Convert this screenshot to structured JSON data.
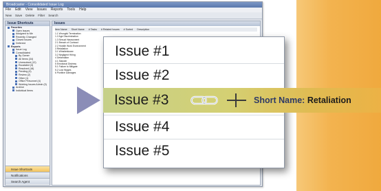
{
  "app": {
    "title": "Broadcaster - Consolidated Issue Log",
    "menu": [
      "File",
      "Edit",
      "View",
      "Issues",
      "Reports",
      "Tools",
      "Help"
    ],
    "toolbar": [
      "New",
      "Save",
      "Delete",
      "Filter",
      "Search"
    ]
  },
  "left_pane": {
    "header": "Issue Shortcuts",
    "items": [
      {
        "label": "Favorites",
        "level": "sec"
      },
      {
        "label": "Open Issues",
        "level": "l1"
      },
      {
        "label": "Assigned to Me",
        "level": "l1"
      },
      {
        "label": "Recently Changed",
        "level": "l1"
      },
      {
        "label": "Closed Issues",
        "level": "l1"
      },
      {
        "label": "Deferred",
        "level": "l1"
      },
      {
        "label": "Reports",
        "level": "sec"
      },
      {
        "label": "Issue Log",
        "level": "l1"
      },
      {
        "label": "Consolidated",
        "level": "l1"
      },
      {
        "label": "By Owner",
        "level": "l2"
      },
      {
        "label": "All Items (34)",
        "level": "l2"
      },
      {
        "label": "Unresolved (12)",
        "level": "l2"
      },
      {
        "label": "Escalated (3)",
        "level": "l2"
      },
      {
        "label": "Resolved (18)",
        "level": "l2"
      },
      {
        "label": "Pending (4)",
        "level": "l2"
      },
      {
        "label": "Review (2)",
        "level": "l2"
      },
      {
        "label": "Other (1)",
        "level": "l2"
      },
      {
        "label": "Office Personnel (4)",
        "level": "l2"
      },
      {
        "label": "Working Issues Admin (3)",
        "level": "l2"
      },
      {
        "label": "Archive",
        "level": "l1"
      },
      {
        "label": "Individual Items",
        "level": "l1"
      }
    ],
    "nav_buttons": [
      "Issue Shortcuts",
      "Notifications",
      "Search Agent"
    ]
  },
  "main_grid": {
    "title": "Issues",
    "columns": [
      "Item Name",
      "Short Name",
      "# Tasks",
      "# Related Issues",
      "# Sorted",
      "Description"
    ],
    "rows": [
      "1.1 Wrongful Termination",
      "1.2 Age Discrimination",
      "1.3 Sexual Harassment",
      "2.1 Breach of Contract",
      "2.2 Hostile Work Environment",
      "3 Retaliation",
      "3.1 Whistleblower",
      "3.2 Negligent Hiring",
      "4 Defamation",
      "4.1 Slander",
      "5 Emotional Distress",
      "5.1 Failure to Mitigate",
      "5.2 Lost Wages",
      "6 Punitive Damages"
    ]
  },
  "callout": {
    "issues": [
      "Issue #1",
      "Issue #2",
      "Issue #3",
      "Issue #4",
      "Issue #5"
    ],
    "selected_index": 2,
    "link_icon": "chain-link-icon",
    "short_name_label": "Short Name:",
    "short_name_value": "Retaliation"
  },
  "colors": {
    "highlight_start": "#c6d089",
    "highlight_end": "#ecb245",
    "orange_panel": "#f3b34f",
    "pointer": "#8b8db7",
    "short_name_label": "#2e3a66"
  }
}
